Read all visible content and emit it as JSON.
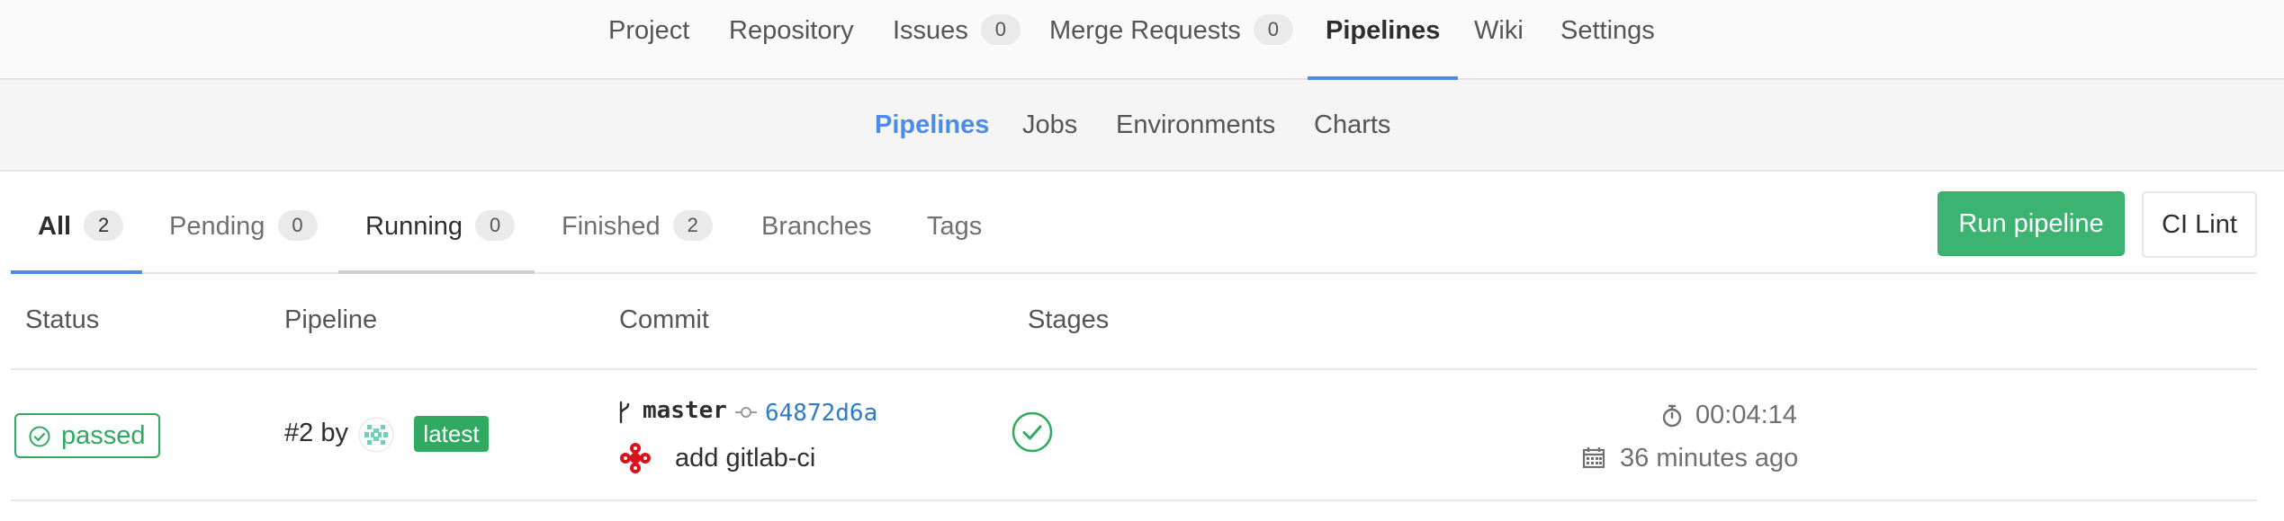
{
  "topnav": {
    "items": [
      {
        "label": "Project"
      },
      {
        "label": "Repository"
      },
      {
        "label": "Issues",
        "count": "0"
      },
      {
        "label": "Merge Requests",
        "count": "0"
      },
      {
        "label": "Pipelines"
      },
      {
        "label": "Wiki"
      },
      {
        "label": "Settings"
      }
    ]
  },
  "subnav": {
    "items": [
      {
        "label": "Pipelines"
      },
      {
        "label": "Jobs"
      },
      {
        "label": "Environments"
      },
      {
        "label": "Charts"
      }
    ]
  },
  "scope_tabs": [
    {
      "label": "All",
      "count": "2"
    },
    {
      "label": "Pending",
      "count": "0"
    },
    {
      "label": "Running",
      "count": "0"
    },
    {
      "label": "Finished",
      "count": "2"
    },
    {
      "label": "Branches"
    },
    {
      "label": "Tags"
    }
  ],
  "actions": {
    "run_pipeline": "Run pipeline",
    "ci_lint": "CI Lint"
  },
  "table": {
    "headers": [
      "Status",
      "Pipeline",
      "Commit",
      "Stages"
    ],
    "rows": [
      {
        "status": "passed",
        "pipeline_id": "#2 by",
        "tag": "latest",
        "branch": "master",
        "sha": "64872d6a",
        "commit_message": "add gitlab-ci",
        "duration": "00:04:14",
        "finished_ago": "36 minutes ago"
      }
    ]
  },
  "colors": {
    "accent": "#4a8bee",
    "success": "#2faa60",
    "button_green": "#3cb371",
    "link": "#2e7cc7"
  },
  "icons": [
    "status-check-circle-icon",
    "branch-icon",
    "commit-icon",
    "stage-passed-icon",
    "timer-icon",
    "calendar-icon",
    "user-avatar-icon",
    "author-avatar-icon"
  ]
}
